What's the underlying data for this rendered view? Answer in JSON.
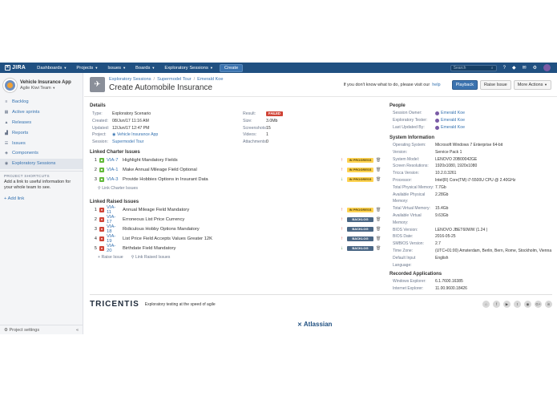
{
  "topnav": {
    "logo": "JIRA",
    "items": [
      "Dashboards",
      "Projects",
      "Issues",
      "Boards",
      "Exploratory Sessions"
    ],
    "create": "Create",
    "search_placeholder": "Search"
  },
  "sidebar": {
    "project_name": "Vehicle Insurance App",
    "team": "Agile Kiwi Team",
    "items": [
      {
        "label": "Backlog",
        "icon": "backlog-icon"
      },
      {
        "label": "Active sprints",
        "icon": "sprint-icon"
      },
      {
        "label": "Releases",
        "icon": "ship-icon"
      },
      {
        "label": "Reports",
        "icon": "chart-icon"
      },
      {
        "label": "Issues",
        "icon": "issues-icon"
      },
      {
        "label": "Components",
        "icon": "components-icon"
      },
      {
        "label": "Exploratory Sessions",
        "icon": "session-icon"
      }
    ],
    "shortcuts_heading": "PROJECT SHORTCUTS",
    "shortcuts_text": "Add a link to useful information for your whole team to see.",
    "add_link": "+ Add link",
    "settings": "Project settings"
  },
  "header": {
    "breadcrumbs": [
      "Exploratory Sessions",
      "Supermodel Tour",
      "Emerald Koe"
    ],
    "title": "Create Automobile Insurance",
    "help_text": "If you don't know what to do, please visit our",
    "help_link": "help",
    "playback": "Playback",
    "raise_issue": "Raise Issue",
    "more_actions": "More Actions"
  },
  "details": {
    "heading": "Details",
    "type_label": "Type:",
    "type_value": "Exploratory Scenario",
    "created_label": "Created:",
    "created_value": "08/Jun/17 11:16 AM",
    "updated_label": "Updated:",
    "updated_value": "12/Jun/17 12:47 PM",
    "project_label": "Project:",
    "project_value": "Vehicle Insurance App",
    "session_label": "Session:",
    "session_value": "Supermodel Tour",
    "result_label": "Result:",
    "result_value": "FAILED",
    "size_label": "Size:",
    "size_value": "3.0Mb",
    "screenshots_label": "Screenshots:",
    "screenshots_value": "15",
    "videos_label": "Videos:",
    "videos_value": "1",
    "attachments_label": "Attachments:",
    "attachments_value": "0"
  },
  "charter": {
    "heading": "Linked Charter Issues",
    "rows": [
      {
        "num": "1",
        "key": "VIA-7",
        "summary": "Highlight Mandatory Fields",
        "prio": "↑",
        "status": "IN PROGRESS"
      },
      {
        "num": "2",
        "key": "VIA-1",
        "summary": "Make Annual Mileage Field Optional",
        "prio": "↑",
        "status": "IN PROGRESS"
      },
      {
        "num": "3",
        "key": "VIA-3",
        "summary": "Provide Hobbies Options in Insurant Data",
        "prio": "↓",
        "status": "IN PROGRESS"
      }
    ],
    "action": "Link Charter Issues"
  },
  "raised": {
    "heading": "Linked Raised Issues",
    "rows": [
      {
        "num": "1",
        "key": "VIA-11",
        "summary": "Annual Mileage Field Mandatory",
        "prio": "↑",
        "status": "IN PROGRESS",
        "kind": "progress"
      },
      {
        "num": "2",
        "key": "VIA-17",
        "summary": "Erroneous List Price Currency",
        "prio": "↑",
        "status": "BACKLOG",
        "kind": "backlog"
      },
      {
        "num": "3",
        "key": "VIA-18",
        "summary": "Ridiculous Hobby Options Mandatory",
        "prio": "↑",
        "status": "BACKLOG",
        "kind": "backlog"
      },
      {
        "num": "4",
        "key": "VIA-19",
        "summary": "List Price Field Accepts Values Greater 12K",
        "prio": "↑",
        "status": "BACKLOG",
        "kind": "backlog"
      },
      {
        "num": "5",
        "key": "VIA-20",
        "summary": "Birthdate Field Mandatory",
        "prio": "↓",
        "status": "BACKLOG",
        "kind": "backlog"
      }
    ],
    "raise": "Raise Issue",
    "link": "Link Raised Issues"
  },
  "people": {
    "heading": "People",
    "rows": [
      {
        "label": "Session Owner:",
        "value": "Emerald Koe"
      },
      {
        "label": "Exploratory Tester:",
        "value": "Emerald Koe"
      },
      {
        "label": "Last Updated By:",
        "value": "Emerald Koe"
      }
    ]
  },
  "system": {
    "heading": "System Information",
    "rows": [
      {
        "label": "Operating System:",
        "value": "Microsoft Windows 7 Enterprise 64-bit"
      },
      {
        "label": "Version:",
        "value": "Service Pack 1"
      },
      {
        "label": "System Model:",
        "value": "LENOVO 20B00042GE"
      },
      {
        "label": "Screen Resolutions:",
        "value": "1920x1080, 1920x1080"
      },
      {
        "label": "Tricca Version:",
        "value": "10.2.0.3261"
      },
      {
        "label": "Processor:",
        "value": "Intel(R) Core(TM) i7-5500U CPU @ 2.40GHz"
      },
      {
        "label": "Total Physical Memory:",
        "value": "7.7Gb"
      },
      {
        "label": "Available Physical Memory:",
        "value": "2.28Gb"
      },
      {
        "label": "Total Virtual Memory:",
        "value": "15.4Gb"
      },
      {
        "label": "Available Virtual Memory:",
        "value": "9.63Gb"
      },
      {
        "label": "BIOS Version:",
        "value": "LENOVO JBET60WW (1.24 )"
      },
      {
        "label": "BIOS Date:",
        "value": "2016-05-25"
      },
      {
        "label": "SMBIOS Version:",
        "value": "2.7"
      },
      {
        "label": "Time Zone:",
        "value": "(UTC+01:00) Amsterdam, Berlin, Bern, Rome, Stockholm, Vienna"
      },
      {
        "label": "Default Input Language:",
        "value": "English"
      }
    ]
  },
  "apps": {
    "heading": "Recorded Applications",
    "rows": [
      {
        "label": "Windows Explorer:",
        "value": "6.1.7600.16385"
      },
      {
        "label": "Internet Explorer:",
        "value": "11.00.9600.18426"
      }
    ]
  },
  "footer": {
    "tricentis": "TRICENTIS",
    "tagline": "Exploratory testing at the speed of agile",
    "social": [
      "⌂",
      "f",
      "▶",
      "t",
      "◉",
      "G+",
      "in"
    ],
    "atlassian": "Atlassian"
  }
}
